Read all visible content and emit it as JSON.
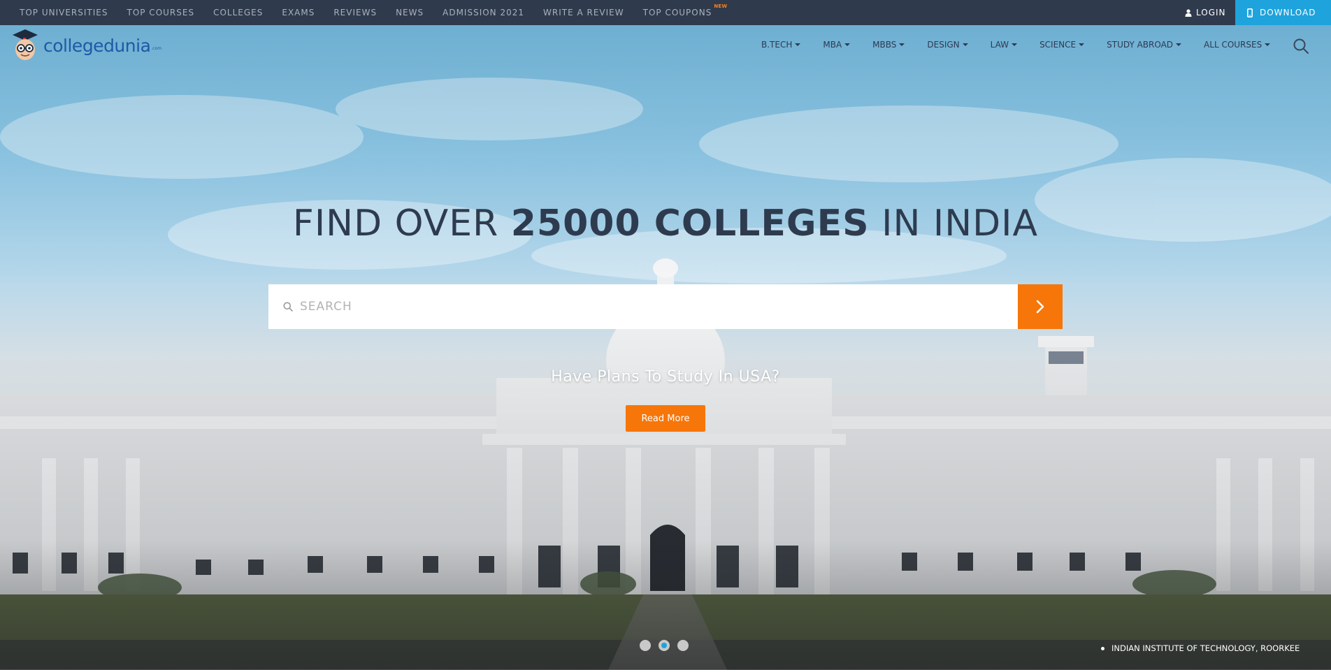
{
  "topbar": {
    "links": [
      "TOP UNIVERSITIES",
      "TOP COURSES",
      "COLLEGES",
      "EXAMS",
      "REVIEWS",
      "NEWS",
      "ADMISSION 2021",
      "WRITE A REVIEW",
      "TOP COUPONS"
    ],
    "new_badge": "NEW",
    "login_label": "LOGIN",
    "download_label": "DOWNLOAD"
  },
  "brand": {
    "name": "collegedunia",
    "suffix": ".com"
  },
  "mainnav": {
    "items": [
      "B.TECH",
      "MBA",
      "MBBS",
      "DESIGN",
      "LAW",
      "SCIENCE",
      "STUDY ABROAD",
      "ALL COURSES"
    ]
  },
  "hero": {
    "headline_part1": "FIND OVER ",
    "headline_bold": "25000 COLLEGES",
    "headline_part2": " IN INDIA",
    "search_placeholder": "SEARCH",
    "promo_text": "Have Plans To Study In USA?",
    "promo_button": "Read More",
    "caption": "INDIAN INSTITUTE OF TECHNOLOGY, ROORKEE",
    "carousel_active_index": 2,
    "carousel_count": 3
  },
  "colors": {
    "topbar_bg": "#2f3a4d",
    "accent_orange": "#f6760a",
    "download_blue": "#1ea3dc",
    "headline": "#2e3b4f"
  },
  "icons": [
    "user-icon",
    "mobile-icon",
    "search-icon",
    "chevron-right-icon",
    "caret-down-icon"
  ]
}
